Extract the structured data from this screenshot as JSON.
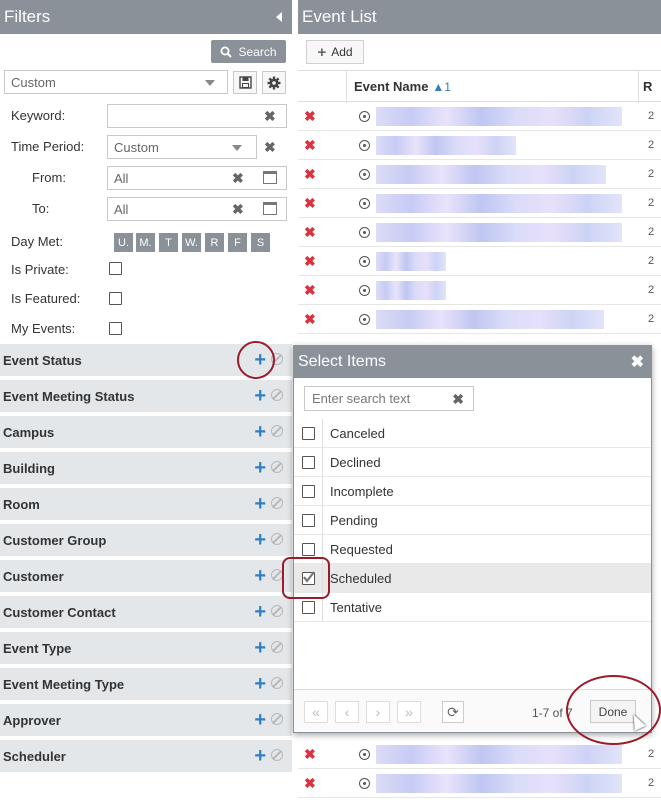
{
  "filters": {
    "title": "Filters",
    "search_label": "Search",
    "saved_filter": "Custom",
    "keyword_label": "Keyword:",
    "keyword_value": "",
    "time_period_label": "Time Period:",
    "time_period_value": "Custom",
    "from_label": "From:",
    "from_value": "All",
    "to_label": "To:",
    "to_value": "All",
    "day_met_label": "Day Met:",
    "days": [
      "U.",
      "M.",
      "T",
      "W.",
      "R",
      "F",
      "S"
    ],
    "is_private_label": "Is Private:",
    "is_featured_label": "Is Featured:",
    "my_events_label": "My Events:",
    "sections": [
      "Event Status",
      "Event Meeting Status",
      "Campus",
      "Building",
      "Room",
      "Customer Group",
      "Customer",
      "Customer Contact",
      "Event Type",
      "Event Meeting Type",
      "Approver",
      "Scheduler"
    ]
  },
  "event_list": {
    "title": "Event List",
    "add_label": "Add",
    "col_event_name": "Event Name",
    "col_r": "R",
    "row_count_top": 8,
    "row_count_bottom": 2
  },
  "dialog": {
    "title": "Select Items",
    "search_placeholder": "Enter search text",
    "options": [
      {
        "label": "Canceled",
        "checked": false
      },
      {
        "label": "Declined",
        "checked": false
      },
      {
        "label": "Incomplete",
        "checked": false
      },
      {
        "label": "Pending",
        "checked": false
      },
      {
        "label": "Requested",
        "checked": false
      },
      {
        "label": "Scheduled",
        "checked": true
      },
      {
        "label": "Tentative",
        "checked": false
      }
    ],
    "pager_info": "1-7 of 7",
    "done_label": "Done"
  },
  "colors": {
    "header_gray": "#8a9199",
    "section_bg": "#e4e7ea",
    "plus_blue": "#2f7fc1",
    "delete_red": "#d9333f",
    "highlight_ring": "#9c1b2b"
  }
}
